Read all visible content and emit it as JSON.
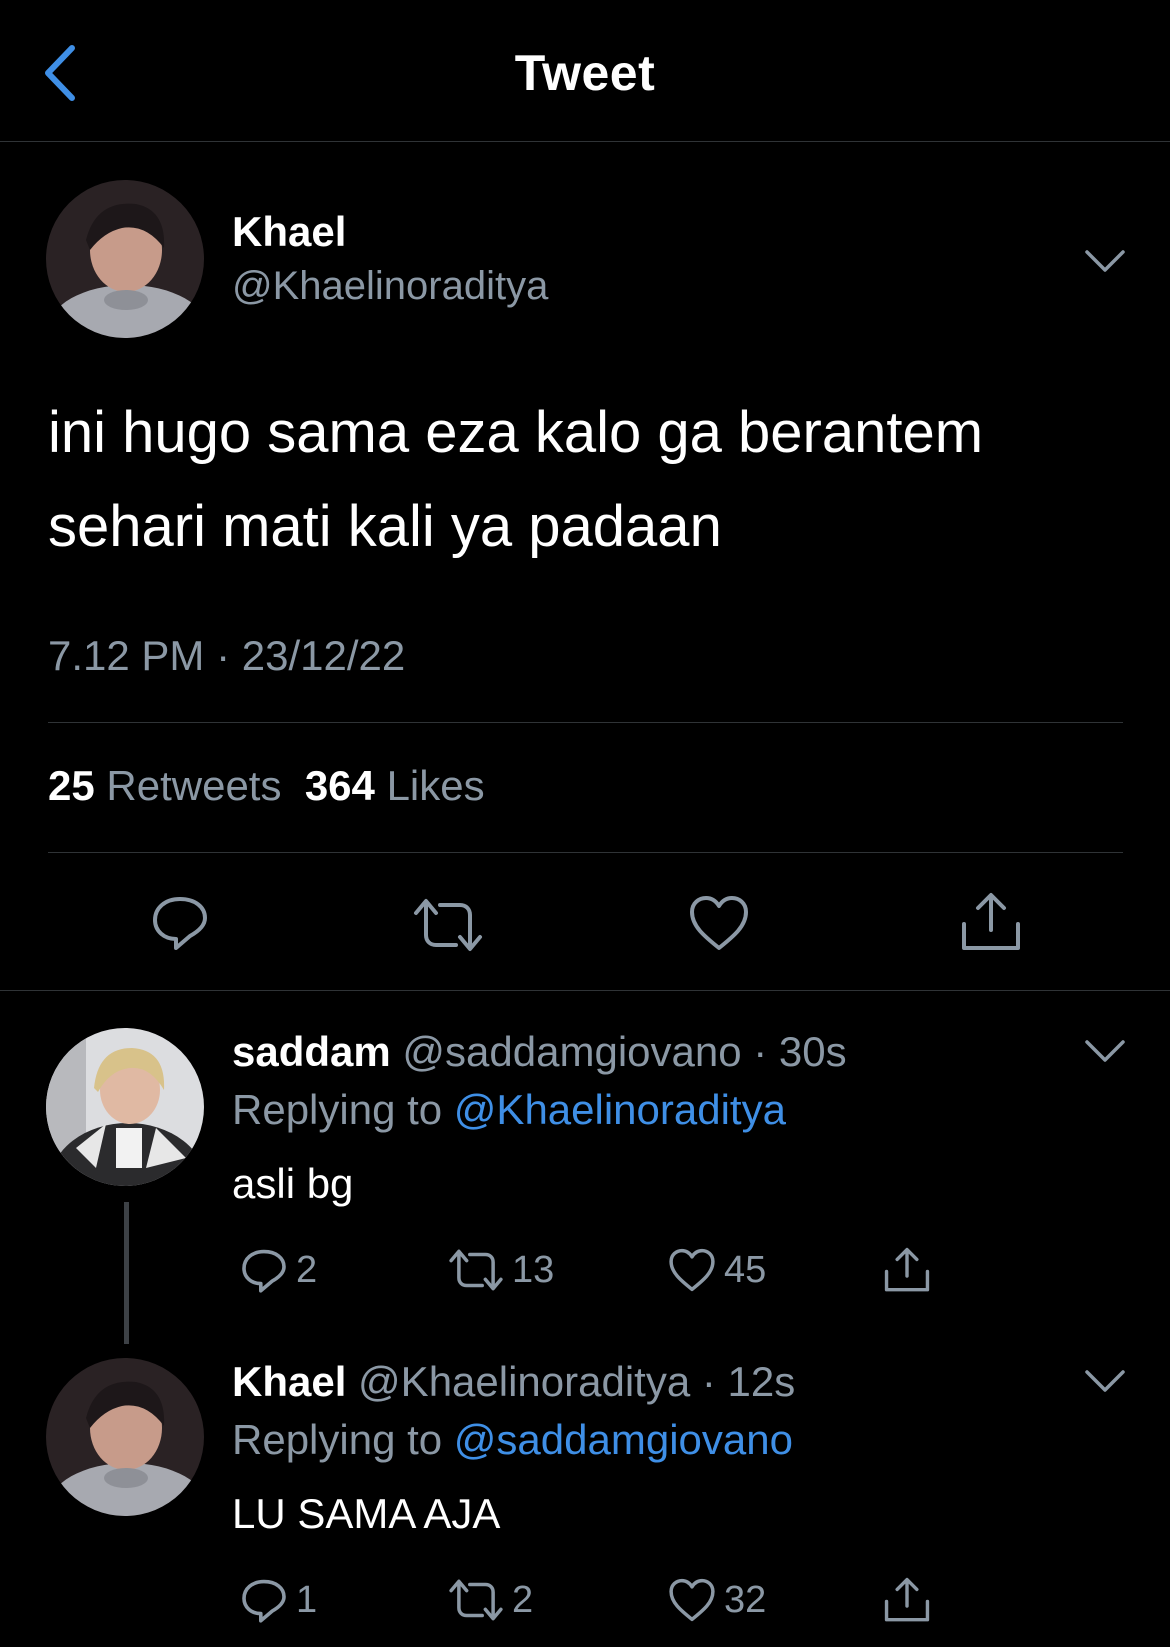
{
  "header": {
    "title": "Tweet"
  },
  "main_tweet": {
    "name": "Khael",
    "handle": "@Khaelinoraditya",
    "text_line1": "ini hugo sama eza kalo ga berantem",
    "text_line2": "sehari mati kali ya padaan",
    "timestamp": "7.12 PM · 23/12/22",
    "retweets_count": "25",
    "retweets_label": "Retweets",
    "likes_count": "364",
    "likes_label": "Likes"
  },
  "replies": [
    {
      "name": "saddam",
      "handle": "@saddamgiovano",
      "time": "· 30s",
      "replying_label": "Replying to",
      "replying_to": "@Khaelinoraditya",
      "text": "asli bg",
      "reply_count": "2",
      "retweet_count": "13",
      "like_count": "45"
    },
    {
      "name": "Khael",
      "handle": "@Khaelinoraditya",
      "time": "· 12s",
      "replying_label": "Replying to",
      "replying_to": "@saddamgiovano",
      "text": "LU SAMA AJA",
      "reply_count": "1",
      "retweet_count": "2",
      "like_count": "32"
    }
  ],
  "colors": {
    "background": "#000000",
    "accent": "#3f8fe6",
    "muted": "#8b98a5",
    "divider": "#2f3336"
  }
}
